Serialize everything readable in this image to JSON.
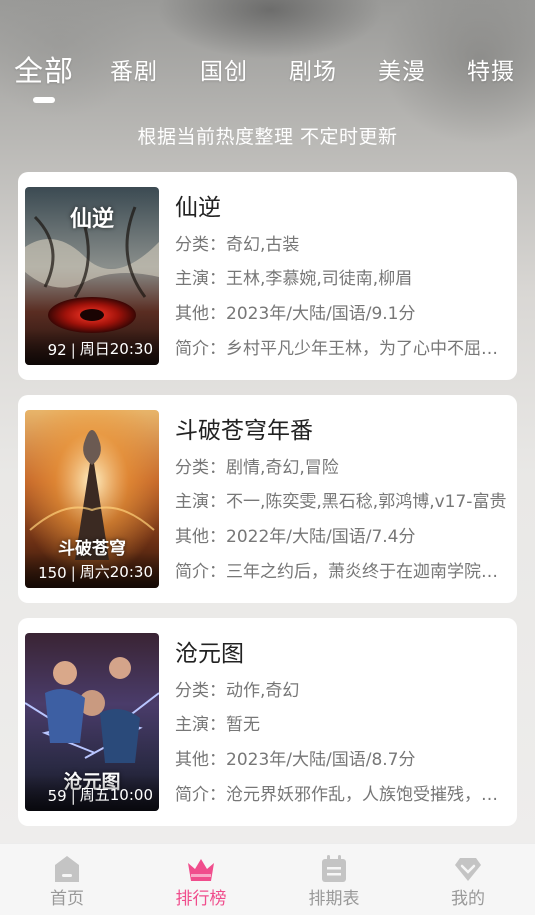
{
  "tabs": [
    "全部",
    "番剧",
    "国创",
    "剧场",
    "美漫",
    "特摄"
  ],
  "subtitle": "根据当前热度整理 不定时更新",
  "labels": {
    "genre": "分类：",
    "cast": "主演：",
    "other": "其他：",
    "intro": "简介："
  },
  "items": [
    {
      "title": "仙逆",
      "poster_title": "仙逆",
      "episodes": "92",
      "schedule": "周日20:30",
      "genre": "奇幻,古装",
      "cast": "王林,李慕婉,司徒南,柳眉",
      "other": "2023年/大陆/国语/9.1分",
      "intro": "乡村平凡少年王林，为了心中不屈的执念，踏上修仙之路"
    },
    {
      "title": "斗破苍穹年番",
      "poster_title": "斗破苍穹",
      "episodes": "150",
      "schedule": "周六20:30",
      "genre": "剧情,奇幻,冒险",
      "cast": "不一,陈奕雯,黑石稔,郭鸿博,v17-富贵",
      "other": "2022年/大陆/国语/7.4分",
      "intro": "三年之约后，萧炎终于在迦南学院见到了萧薰儿"
    },
    {
      "title": "沧元图",
      "poster_title": "沧元图",
      "episodes": "59",
      "schedule": "周五10:00",
      "genre": "动作,奇幻",
      "cast": "暂无",
      "other": "2023年/大陆/国语/8.7分",
      "intro": "沧元界妖邪作乱，人族饱受摧残，少年孟川立志斩妖"
    }
  ],
  "tabbar": {
    "home": "首页",
    "ranking": "排行榜",
    "schedule": "排期表",
    "mine": "我的"
  },
  "colors": {
    "accent": "#f04d8c",
    "inactive": "#999999"
  }
}
